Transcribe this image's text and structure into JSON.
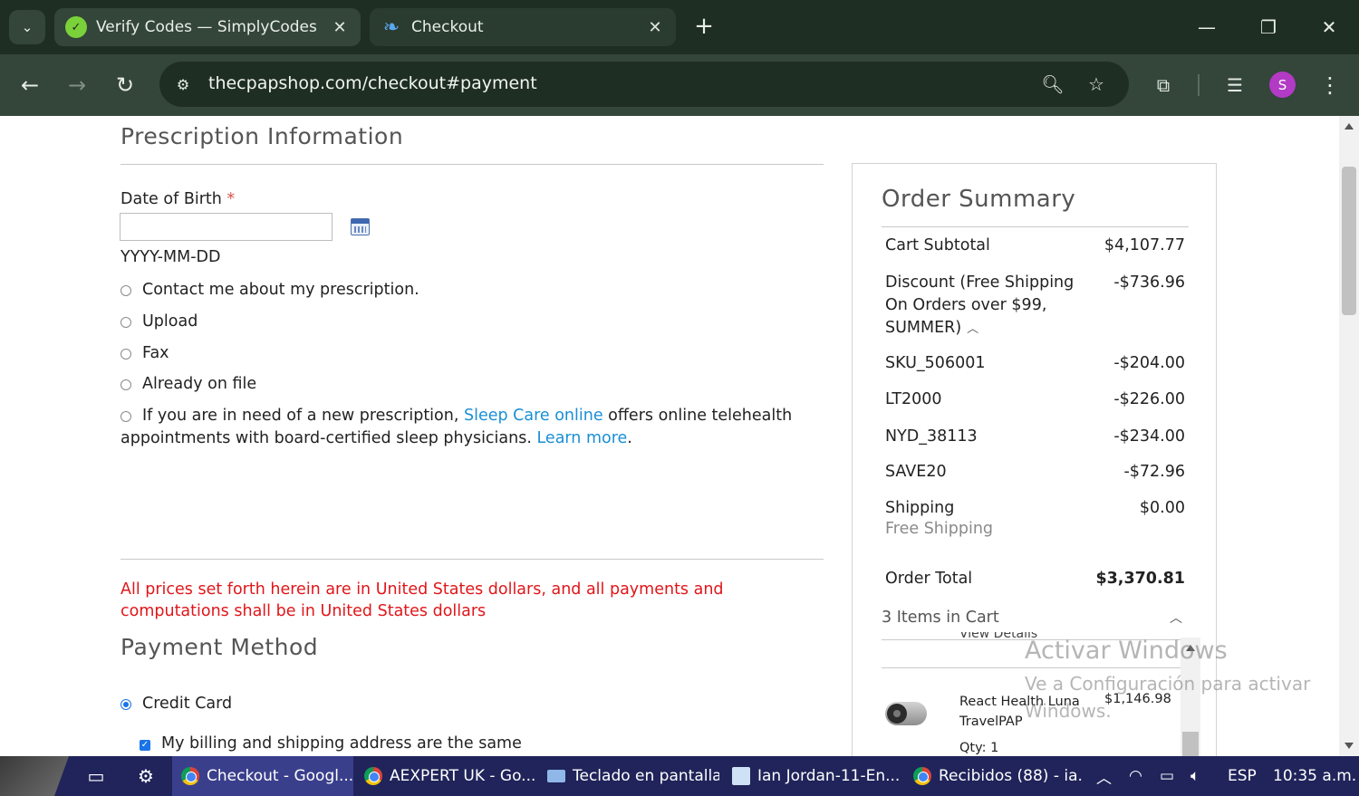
{
  "browser": {
    "tabs": [
      {
        "title": "Verify Codes — SimplyCodes",
        "icon": "simplycodes-icon"
      },
      {
        "title": "Checkout",
        "icon": "cpapshop-icon"
      }
    ],
    "url": "thecpapshop.com/checkout#payment",
    "profile_initial": "S"
  },
  "prescription": {
    "title": "Prescription Information",
    "dob_label": "Date of Birth",
    "required_mark": "*",
    "dob_value": "",
    "dob_hint": "YYYY-MM-DD",
    "options": [
      "Contact me about my prescription.",
      "Upload",
      "Fax",
      "Already on file"
    ],
    "telehealth": {
      "prefix": "If you are in need of a new prescription, ",
      "link1": "Sleep Care online",
      "middle": " offers online telehealth appointments with board-certified sleep physicians. ",
      "link2": "Learn more",
      "suffix": "."
    }
  },
  "currency_note": "All prices set forth herein are in United States dollars, and all payments and computations shall be in United States dollars",
  "payment": {
    "title": "Payment Method",
    "method": "Credit Card",
    "billing_same": "My billing and shipping address are the same"
  },
  "summary": {
    "title": "Order Summary",
    "subtotal_label": "Cart Subtotal",
    "subtotal_value": "$4,107.77",
    "discount_label": "Discount (Free Shipping On Orders over $99, SUMMER)",
    "discount_value": "-$736.96",
    "discount_lines": [
      {
        "code": "SKU_506001",
        "amount": "-$204.00"
      },
      {
        "code": "LT2000",
        "amount": "-$226.00"
      },
      {
        "code": "NYD_38113",
        "amount": "-$234.00"
      },
      {
        "code": "SAVE20",
        "amount": "-$72.96"
      }
    ],
    "shipping_label": "Shipping",
    "shipping_value": "$0.00",
    "shipping_method": "Free Shipping",
    "total_label": "Order Total",
    "total_value": "$3,370.81",
    "items_in_cart": "3 Items in Cart",
    "view_details": "View Details",
    "product": {
      "name": "React Health Luna TravelPAP",
      "price": "$1,146.98",
      "qty": "Qty: 1"
    }
  },
  "watermark": {
    "line1": "Activar Windows",
    "line2": "Ve a Configuración para activar Windows."
  },
  "taskbar": {
    "tasks": [
      {
        "label": "Checkout - Googl...",
        "icon": "chrome-icon",
        "active": true
      },
      {
        "label": "AEXPERT UK - Go...",
        "icon": "chrome-icon",
        "active": false
      },
      {
        "label": "Teclado en pantalla",
        "icon": "keyboard-icon",
        "active": false
      },
      {
        "label": "Ian Jordan-11-En...",
        "icon": "notepad-icon",
        "active": false
      },
      {
        "label": "Recibidos (88) - ia...",
        "icon": "chrome-icon",
        "active": false
      }
    ],
    "language": "ESP",
    "time": "10:35 a.m."
  }
}
